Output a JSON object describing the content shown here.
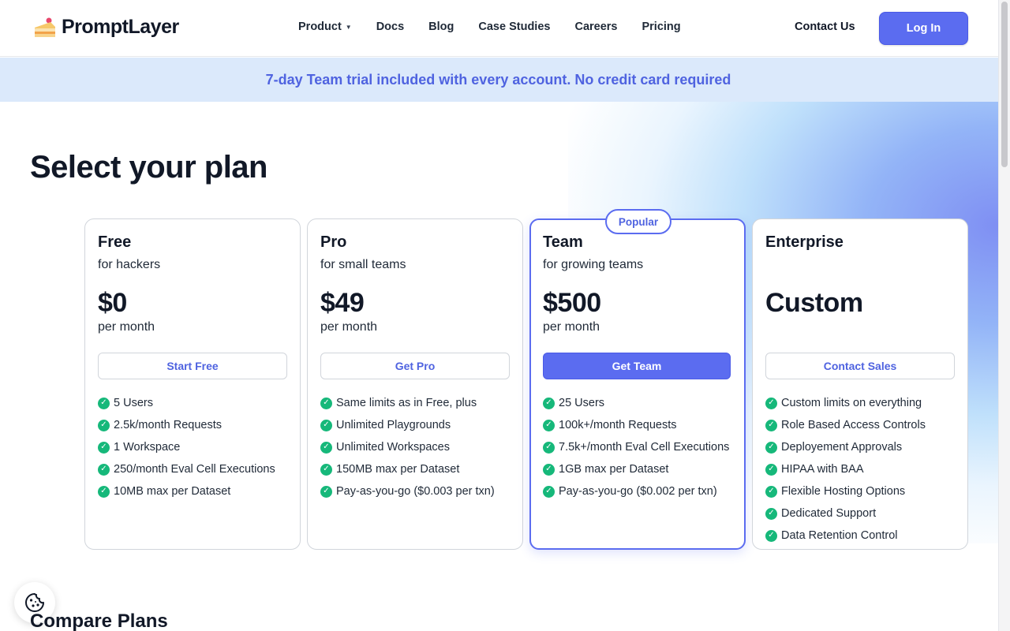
{
  "header": {
    "logo_text": "PromptLayer",
    "nav": [
      "Product",
      "Docs",
      "Blog",
      "Case Studies",
      "Careers",
      "Pricing"
    ],
    "contact": "Contact Us",
    "login": "Log In"
  },
  "banner": "7-day Team trial included with every account. No credit card required",
  "page_title": "Select your plan",
  "plans": [
    {
      "name": "Free",
      "subtitle": "for hackers",
      "price": "$0",
      "period": "per month",
      "cta": "Start Free",
      "features": [
        "5 Users",
        "2.5k/month Requests",
        "1 Workspace",
        "250/month Eval Cell Executions",
        "10MB max per Dataset"
      ]
    },
    {
      "name": "Pro",
      "subtitle": "for small teams",
      "price": "$49",
      "period": "per month",
      "cta": "Get Pro",
      "features": [
        "Same limits as in Free, plus",
        "Unlimited Playgrounds",
        "Unlimited Workspaces",
        "150MB max per Dataset",
        "Pay-as-you-go ($0.003 per txn)"
      ]
    },
    {
      "name": "Team",
      "subtitle": "for growing teams",
      "price": "$500",
      "period": "per month",
      "cta": "Get Team",
      "badge": "Popular",
      "features": [
        "25 Users",
        "100k+/month Requests",
        "7.5k+/month Eval Cell Executions",
        "1GB max per Dataset",
        "Pay-as-you-go ($0.002 per txn)"
      ]
    },
    {
      "name": "Enterprise",
      "subtitle": "",
      "price": "Custom",
      "period": "",
      "cta": "Contact Sales",
      "features": [
        "Custom limits on everything",
        "Role Based Access Controls",
        "Deployement Approvals",
        "HIPAA with BAA",
        "Flexible Hosting Options",
        "Dedicated Support",
        "Data Retention Control"
      ]
    }
  ],
  "compare_title": "Compare Plans",
  "colors": {
    "accent": "#5b6cf0",
    "check": "#16b87a",
    "banner_bg": "#dbe9fb"
  },
  "icons": {
    "check": "check-circle-icon",
    "cookie": "cookie-icon",
    "logo": "cake-icon",
    "caret": "caret-down-icon"
  }
}
